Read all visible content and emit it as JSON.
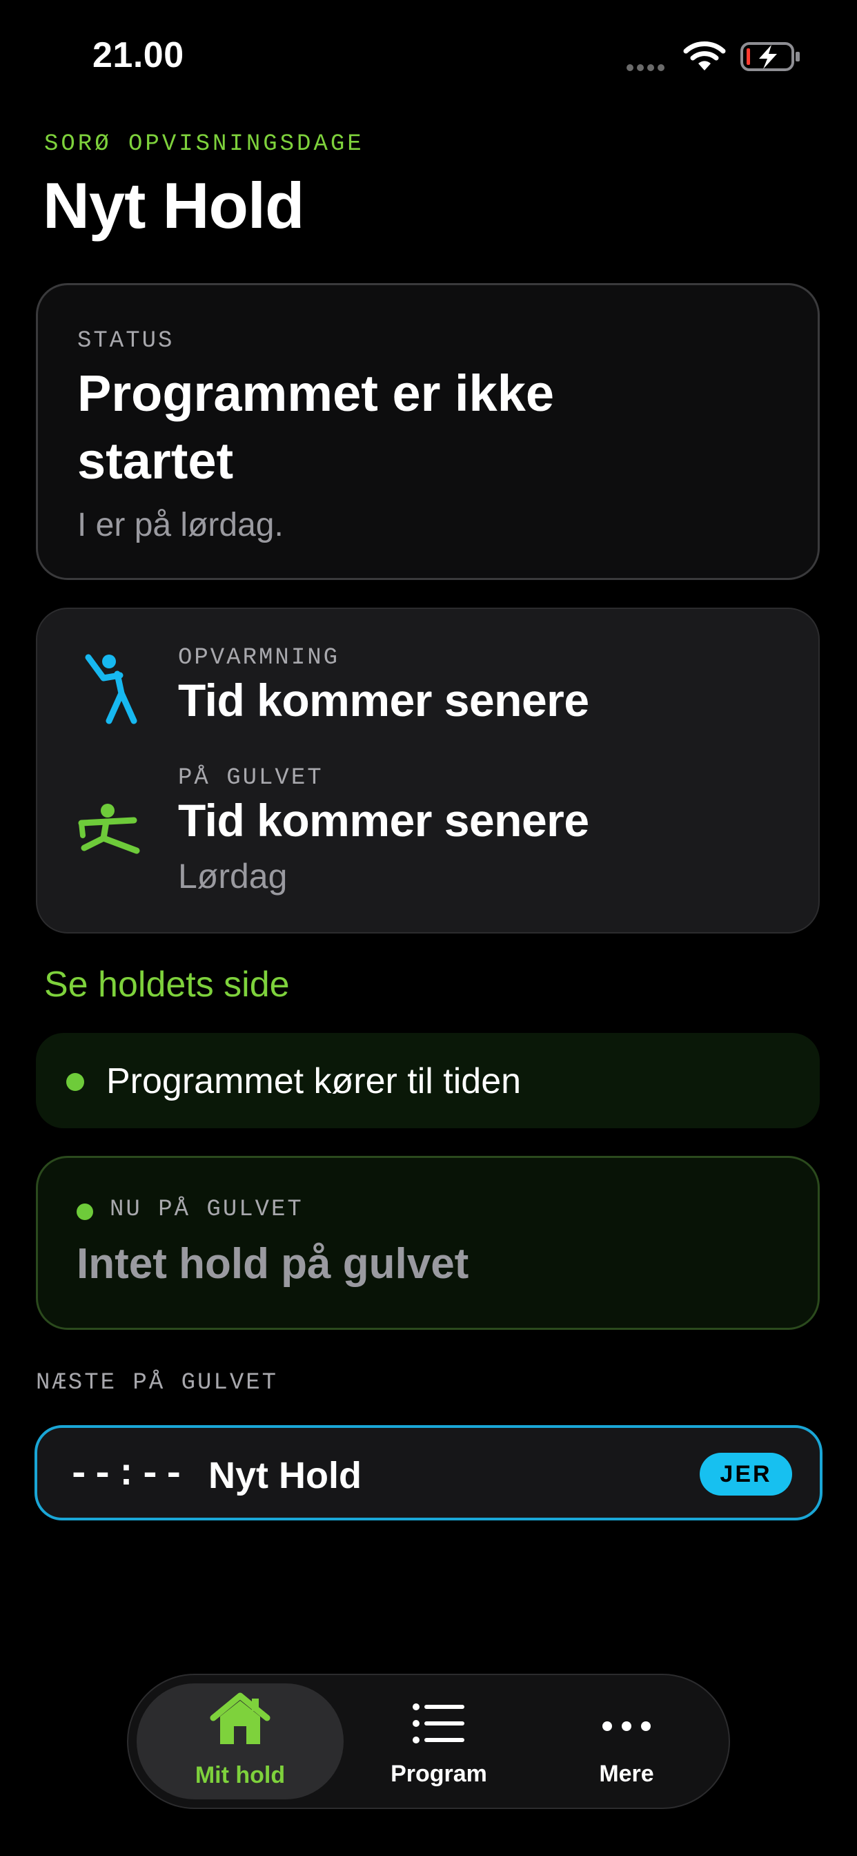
{
  "status_bar": {
    "time": "21.00"
  },
  "header": {
    "event": "SORØ OPVISNINGSDAGE",
    "team": "Nyt Hold"
  },
  "status_card": {
    "label": "STATUS",
    "headline": "Programmet er ikke startet",
    "subtext": "I er på lørdag."
  },
  "times_card": {
    "warmup": {
      "label": "OPVARMNING",
      "value": "Tid kommer senere",
      "icon": "stretch-icon"
    },
    "floor": {
      "label": "PÅ GULVET",
      "value": "Tid kommer senere",
      "day": "Lørdag",
      "icon": "gymnast-icon"
    }
  },
  "team_page_link": "Se holdets side",
  "schedule_status": "Programmet kører til tiden",
  "now_on_floor": {
    "label": "NU PÅ GULVET",
    "value": "Intet hold på gulvet"
  },
  "next_on_floor": {
    "heading": "NÆSTE PÅ GULVET",
    "items": [
      {
        "time": "--:--",
        "team": "Nyt Hold",
        "badge": "JER"
      }
    ]
  },
  "tab_bar": {
    "items": [
      {
        "label": "Mit hold",
        "icon": "home-icon",
        "active": true
      },
      {
        "label": "Program",
        "icon": "list-icon",
        "active": false
      },
      {
        "label": "Mere",
        "icon": "more-icon",
        "active": false
      }
    ]
  },
  "colors": {
    "accent_green": "#7ed23c",
    "badge_blue": "#17c0f0",
    "warmup_icon": "#17b8f0"
  }
}
